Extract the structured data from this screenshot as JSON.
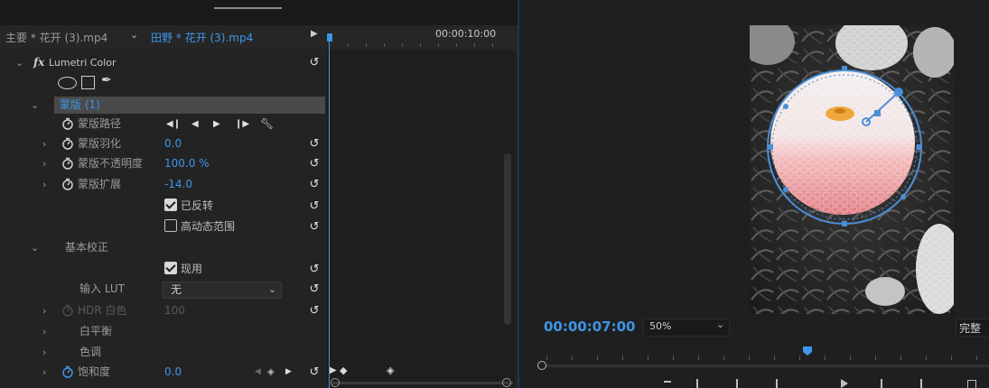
{
  "source_tabs": {
    "master_label": "主要 * 花开 (3).mp4",
    "active_label": "田野 * 花开 (3).mp4"
  },
  "timeline": {
    "timecode": "00:00:10:00"
  },
  "effect": {
    "fx_label": "fx",
    "name": "Lumetri Color",
    "mask_name": "蒙版 (1)",
    "mask_path_label": "蒙版路径",
    "feather_label": "蒙版羽化",
    "feather_value": "0.0",
    "opacity_label": "蒙版不透明度",
    "opacity_value": "100.0 %",
    "expansion_label": "蒙版扩展",
    "expansion_value": "-14.0",
    "inverted_label": "已反转",
    "inverted_checked": true,
    "hdr_label": "高动态范围",
    "hdr_checked": false,
    "basic_section": "基本校正",
    "apply_label": "现用",
    "apply_checked": true,
    "lut_label": "输入 LUT",
    "lut_value": "无",
    "hdr_white_label": "HDR 白色",
    "hdr_white_value": "100",
    "white_balance_label": "白平衡",
    "tone_label": "色调",
    "saturation_label": "饱和度",
    "saturation_value": "0.0"
  },
  "program": {
    "timecode": "00:00:07:00",
    "zoom": "50%",
    "quality": "完整"
  },
  "colors": {
    "accent": "#3e95e8",
    "mask_ring": "#4a8fd8"
  }
}
